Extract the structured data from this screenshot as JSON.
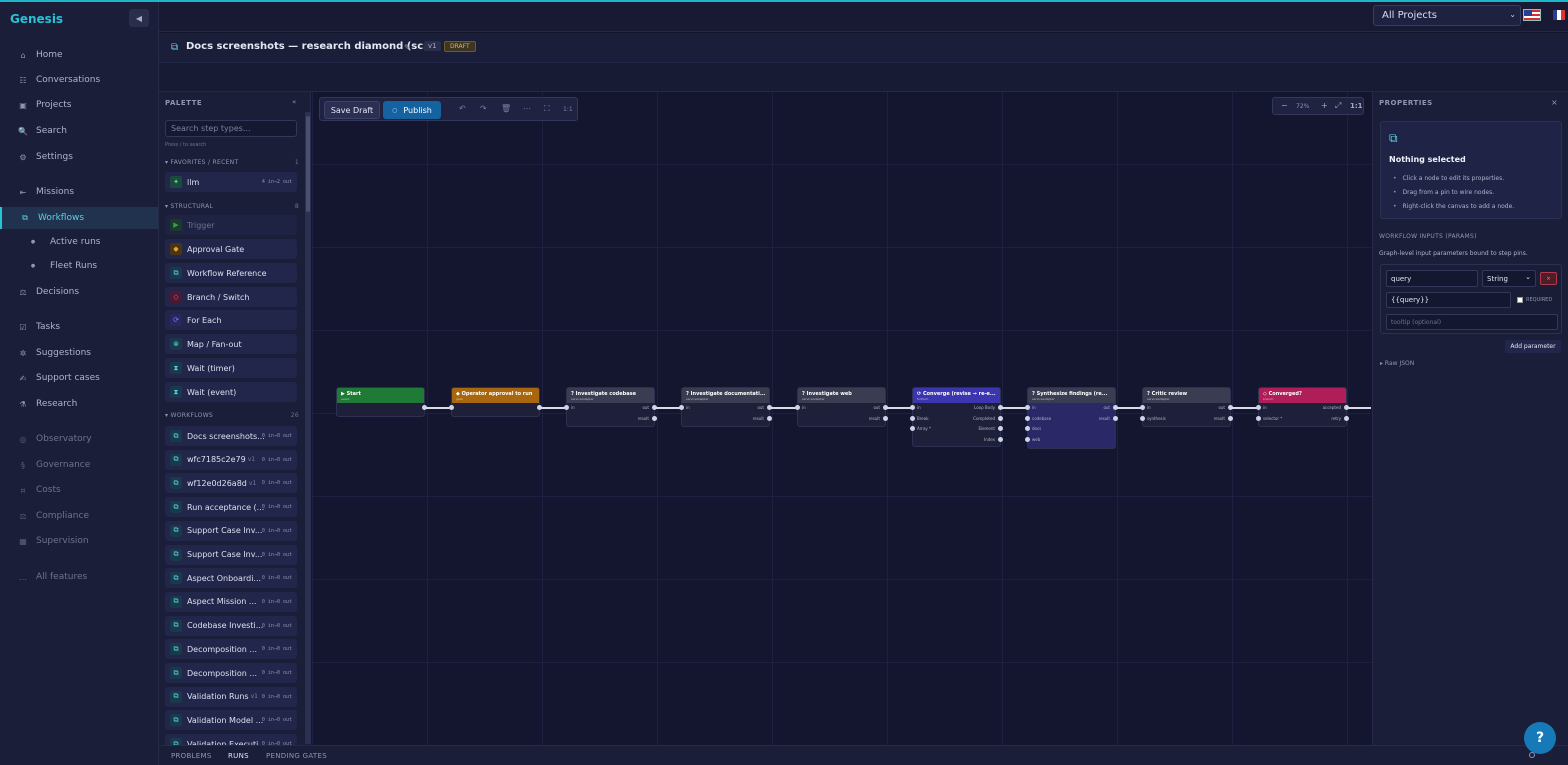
{
  "app": {
    "brand": "Genesis",
    "collapse_icon": "◀"
  },
  "sidebar": {
    "items": [
      {
        "label": "Home",
        "icon": "⌂"
      },
      {
        "label": "Conversations",
        "icon": "☷"
      },
      {
        "label": "Projects",
        "icon": "▣"
      },
      {
        "label": "Search",
        "icon": "🔍"
      },
      {
        "label": "Settings",
        "icon": "⚙"
      },
      {
        "label": "Missions",
        "icon": "⇤"
      },
      {
        "label": "Workflows",
        "icon": "⧉"
      },
      {
        "label": "Active runs",
        "icon": "●"
      },
      {
        "label": "Fleet Runs",
        "icon": "●"
      },
      {
        "label": "Decisions",
        "icon": "⚖"
      },
      {
        "label": "Tasks",
        "icon": "☑"
      },
      {
        "label": "Suggestions",
        "icon": "✲"
      },
      {
        "label": "Support cases",
        "icon": "✍"
      },
      {
        "label": "Research",
        "icon": "⚗"
      },
      {
        "label": "Observatory",
        "icon": "◎"
      },
      {
        "label": "Governance",
        "icon": "§"
      },
      {
        "label": "Costs",
        "icon": "¤"
      },
      {
        "label": "Compliance",
        "icon": "⚖"
      },
      {
        "label": "Supervision",
        "icon": "▦"
      },
      {
        "label": "All features",
        "icon": "…"
      }
    ]
  },
  "header": {
    "project_select": "All Projects",
    "project_chevron": "⌄"
  },
  "workflow": {
    "title": "Docs screenshots — research diamond (scr...",
    "icon": "⧉",
    "edit_icon": "✎",
    "version": "v1",
    "status": "DRAFT"
  },
  "palette": {
    "title": "PALETTE",
    "collapse": "«",
    "search_placeholder": "Search step types...",
    "hint": "Press / to search",
    "sections": {
      "favorites": {
        "label": "FAVORITES / RECENT",
        "count": "1"
      },
      "structural": {
        "label": "STRUCTURAL",
        "count": "8"
      },
      "workflows": {
        "label": "WORKFLOWS",
        "count": "26"
      }
    },
    "favorites": [
      {
        "label": "llm",
        "meta": "4 in→2 out",
        "icon": "✦"
      }
    ],
    "structural": [
      {
        "label": "Trigger",
        "icon": "▶"
      },
      {
        "label": "Approval Gate",
        "icon": "◆"
      },
      {
        "label": "Workflow Reference",
        "icon": "⧉"
      },
      {
        "label": "Branch / Switch",
        "icon": "◇"
      },
      {
        "label": "For Each",
        "icon": "⟳"
      },
      {
        "label": "Map / Fan-out",
        "icon": "⊗"
      },
      {
        "label": "Wait (timer)",
        "icon": "⧗"
      },
      {
        "label": "Wait (event)",
        "icon": "⧗"
      }
    ],
    "workflows": [
      {
        "label": "Docs screenshots...",
        "ver": "",
        "meta": "0 in→0 out"
      },
      {
        "label": "wfc7185c2e79",
        "ver": "v1",
        "meta": "0 in→0 out"
      },
      {
        "label": "wf12e0d26a8d",
        "ver": "v1",
        "meta": "0 in→0 out"
      },
      {
        "label": "Run acceptance (...",
        "ver": "",
        "meta": "0 in→0 out"
      },
      {
        "label": "Support Case Inv...",
        "ver": "",
        "meta": "0 in→0 out"
      },
      {
        "label": "Support Case Inv...",
        "ver": "",
        "meta": "0 in→0 out"
      },
      {
        "label": "Aspect Onboardi...",
        "ver": "",
        "meta": "0 in→0 out"
      },
      {
        "label": "Aspect Mission ...",
        "ver": "",
        "meta": "0 in→0 out"
      },
      {
        "label": "Codebase Investi...",
        "ver": "",
        "meta": "0 in→0 out"
      },
      {
        "label": "Decomposition ...",
        "ver": "",
        "meta": "0 in→0 out"
      },
      {
        "label": "Decomposition ...",
        "ver": "",
        "meta": "0 in→0 out"
      },
      {
        "label": "Validation Runs",
        "ver": "v1",
        "meta": "0 in→0 out"
      },
      {
        "label": "Validation Model ...",
        "ver": "",
        "meta": "0 in→0 out"
      },
      {
        "label": "Validation Executi...",
        "ver": "",
        "meta": "0 in→0 out"
      }
    ]
  },
  "toolbar": {
    "save_label": "Save Draft",
    "publish_label": "Publish",
    "publish_icon": "○",
    "undo": "↶",
    "redo": "↷",
    "delete": "🗑",
    "more": "⋯",
    "fit": "⛶",
    "one_to_one": "1:1"
  },
  "zoom": {
    "minus": "−",
    "level": "72%",
    "plus": "+",
    "fit": "⤢",
    "reset": "1:1"
  },
  "nodes": [
    {
      "title": "Start",
      "subtitle": "event",
      "icon": "▶",
      "color": "#1e7a35"
    },
    {
      "title": "Operator approval to run",
      "subtitle": "gate",
      "icon": "◆",
      "color": "#a8670e"
    },
    {
      "title": "Investigate codebase",
      "subtitle": "serviceAdapter",
      "icon": "?",
      "color": "#3a3d52",
      "in": "in",
      "outs": [
        "out",
        "result"
      ]
    },
    {
      "title": "Investigate documentati...",
      "subtitle": "serviceAdapter",
      "icon": "?",
      "color": "#3a3d52",
      "in": "in",
      "outs": [
        "out",
        "result"
      ]
    },
    {
      "title": "Investigate web",
      "subtitle": "serviceAdapter",
      "icon": "?",
      "color": "#3a3d52",
      "in": "in",
      "outs": [
        "out",
        "result"
      ]
    },
    {
      "title": "Converge (revise → re-e...",
      "subtitle": "forEach",
      "icon": "⟳",
      "color": "#3b35b0",
      "ins": [
        "in",
        "Break",
        "Array *"
      ],
      "outs": [
        "Loop Body",
        "Completed",
        "Element",
        "Index"
      ]
    },
    {
      "title": "Synthesize findings (re...",
      "subtitle": "serviceAdapter",
      "icon": "?",
      "color": "#3a3d52",
      "ins": [
        "in",
        "codebase",
        "docs",
        "web"
      ],
      "outs": [
        "out",
        "result"
      ]
    },
    {
      "title": "Critic review",
      "subtitle": "serviceAdapter",
      "icon": "?",
      "color": "#3a3d52",
      "ins": [
        "in",
        "synthesis"
      ],
      "outs": [
        "out",
        "result"
      ]
    },
    {
      "title": "Converged?",
      "subtitle": "branch",
      "icon": "◇",
      "color": "#b01e5a",
      "ins": [
        "in",
        "selector *"
      ],
      "outs": [
        "accepted",
        "retry"
      ]
    }
  ],
  "properties": {
    "title": "PROPERTIES",
    "close": "×",
    "icon": "⧉",
    "nothing_selected": "Nothing selected",
    "tips": [
      "Click a node to edit its properties.",
      "Drag from a pin to wire nodes.",
      "Right-click the canvas to add a node."
    ],
    "inputs_title": "WORKFLOW INPUTS (PARAMS)",
    "inputs_desc": "Graph-level input parameters bound to step pins.",
    "param": {
      "name": "query",
      "type": "String",
      "type_chevron": "⌄",
      "delete": "×",
      "value": "{{query}}",
      "required": "REQUIRED",
      "tooltip_placeholder": "tooltip (optional)"
    },
    "add_param": "Add parameter",
    "raw_json": "▸ Raw JSON"
  },
  "bottom": {
    "tabs": [
      "PROBLEMS",
      "RUNS",
      "PENDING GATES"
    ],
    "help": "?"
  }
}
